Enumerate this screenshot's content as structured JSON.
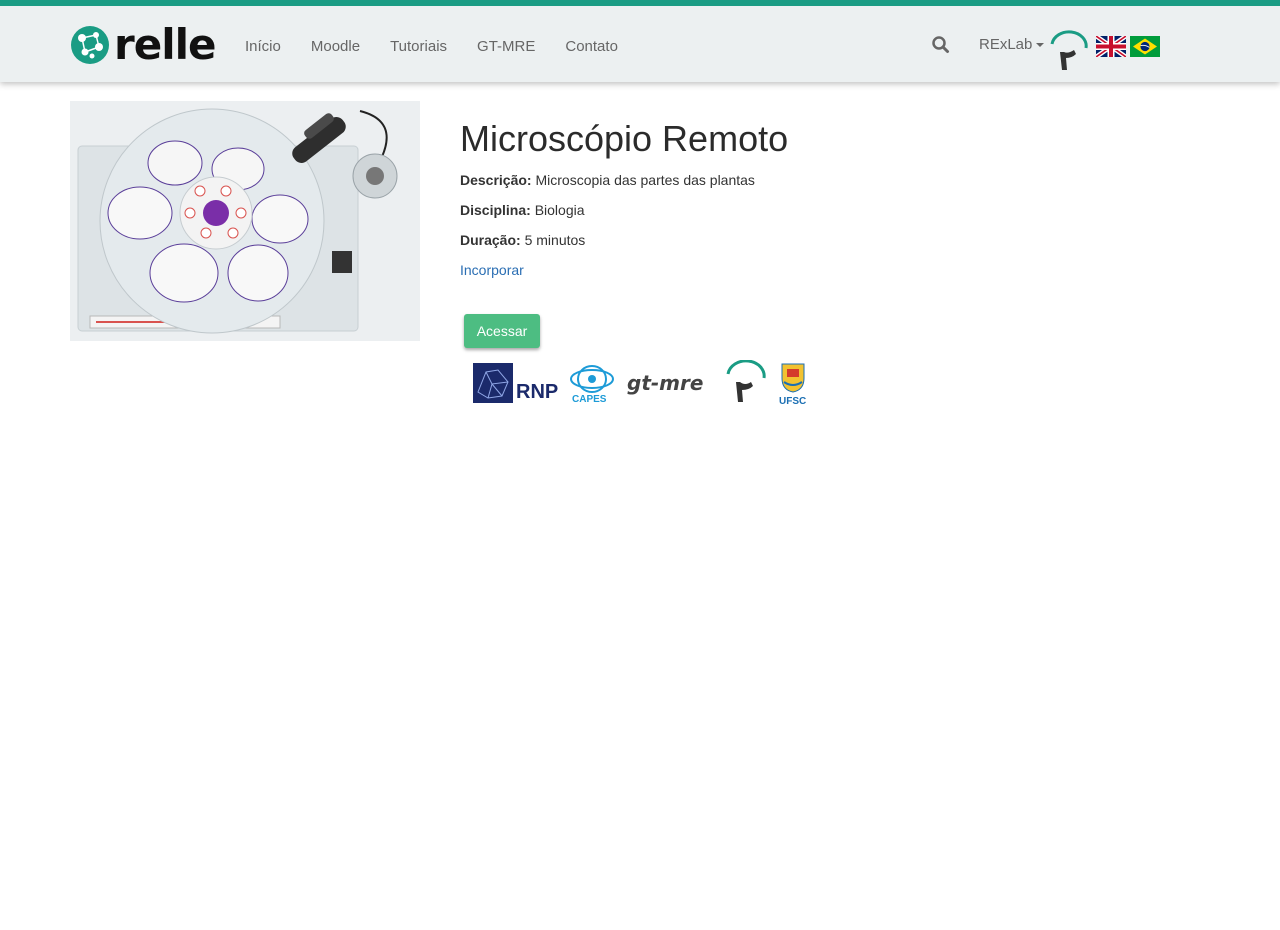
{
  "header": {
    "logo_text": "relle",
    "nav": [
      "Início",
      "Moodle",
      "Tutoriais",
      "GT-MRE",
      "Contato"
    ],
    "rexlab_label": "RExLab",
    "icons": {
      "search": "search-icon",
      "english": "uk-flag-icon",
      "portuguese": "brazil-flag-icon"
    },
    "accent_color": "#1a9c84"
  },
  "lab": {
    "title": "Microscópio Remoto",
    "description_label": "Descrição:",
    "description_value": "Microscopia das partes das plantas",
    "discipline_label": "Disciplina:",
    "discipline_value": "Biologia",
    "duration_label": "Duração:",
    "duration_value": "5 minutos",
    "embed_label": "Incorporar",
    "access_label": "Acessar",
    "access_color": "#4dbd82"
  },
  "partners": {
    "rnp": "RNP",
    "capes": "CAPES",
    "gtmre": "gt-mre",
    "ufsc": "UFSC"
  }
}
